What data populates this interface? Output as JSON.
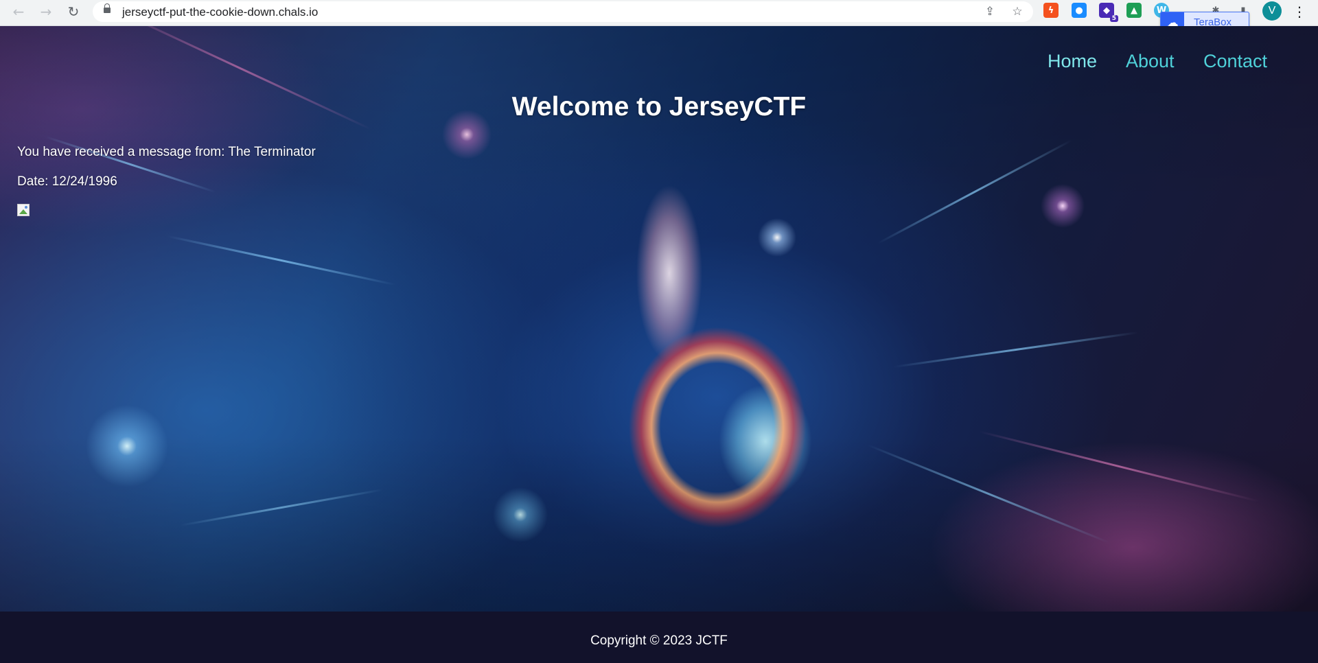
{
  "browser": {
    "url": "jerseyctf-put-the-cookie-down.chals.io",
    "back_icon": "←",
    "forward_icon": "→",
    "reload_icon": "↻",
    "share_icon": "⇪",
    "star_icon": "☆",
    "extensions": [
      {
        "name": "zap-extension-icon",
        "glyph": "ϟ",
        "color": "#f4511e"
      },
      {
        "name": "drop-extension-icon",
        "glyph": "●",
        "color": "#1a8cff"
      },
      {
        "name": "hat-extension-icon",
        "glyph": "◆",
        "color": "#4a2bb5",
        "badge": "5"
      },
      {
        "name": "drive-extension-icon",
        "glyph": "▲",
        "color": "#1e9e55"
      },
      {
        "name": "w-extension-icon",
        "glyph": "W",
        "color": "#3fb6e8"
      },
      {
        "name": "puzzle-icon",
        "glyph": "✱",
        "color": "#5f6368"
      },
      {
        "name": "side-panel-icon",
        "glyph": "▮",
        "color": "#5f6368"
      }
    ],
    "terabox": {
      "label": "TeraBox",
      "icon": "☁"
    },
    "avatar_letter": "V",
    "menu_icon": "⋮"
  },
  "site": {
    "nav": [
      {
        "label": "Home",
        "active": true
      },
      {
        "label": "About",
        "active": false
      },
      {
        "label": "Contact",
        "active": false
      }
    ],
    "title": "Welcome to JerseyCTF",
    "message_line": "You have received a message from: The Terminator",
    "date_line": "Date: 12/24/1996",
    "footer": "Copyright © 2023 JCTF"
  },
  "colors": {
    "nav_link": "#4fd1d9",
    "footer_bg": "#12122b",
    "terabox_accent": "#2f62f5"
  }
}
